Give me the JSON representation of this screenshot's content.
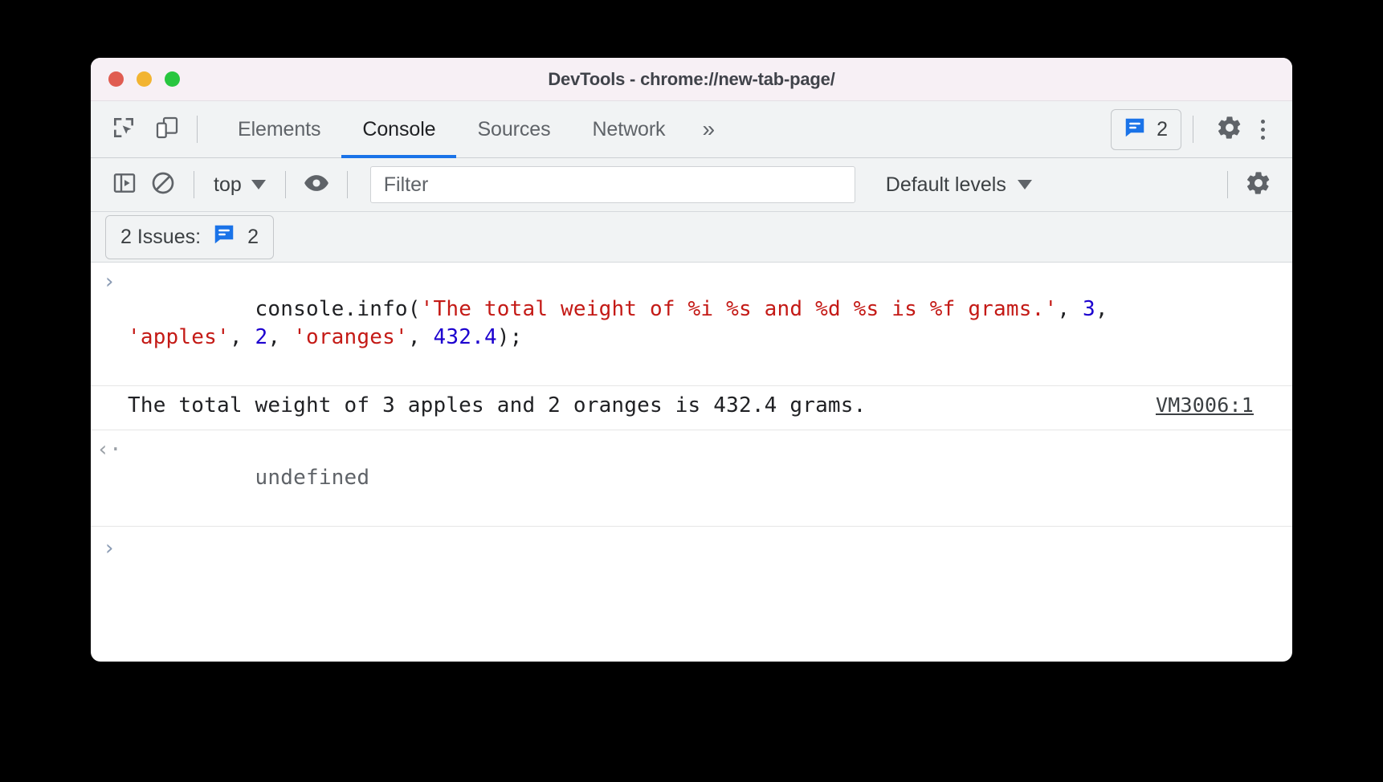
{
  "window": {
    "title": "DevTools - chrome://new-tab-page/",
    "traffic_lights": [
      {
        "name": "close",
        "color": "#e05c51"
      },
      {
        "name": "minimize",
        "color": "#f2b431"
      },
      {
        "name": "zoom",
        "color": "#28c63f"
      }
    ]
  },
  "tabbar": {
    "icons": [
      {
        "name": "inspect-element-icon",
        "label": "Inspect element"
      },
      {
        "name": "device-toolbar-icon",
        "label": "Toggle device toolbar"
      }
    ],
    "tabs": [
      {
        "label": "Elements",
        "active": false
      },
      {
        "label": "Console",
        "active": true
      },
      {
        "label": "Sources",
        "active": false
      },
      {
        "label": "Network",
        "active": false
      }
    ],
    "overflow_label": "»",
    "issues_badge": {
      "count": "2",
      "icon": "issues-icon",
      "color": "#1a73e8"
    },
    "settings_label": "Settings",
    "more_label": "Customize and control DevTools"
  },
  "console_toolbar": {
    "sidebar_toggle": "console-sidebar-icon",
    "clear_console": "clear-console-icon",
    "context_selector": {
      "value": "top"
    },
    "live_expression": "eye-icon",
    "filter": {
      "placeholder": "Filter",
      "value": ""
    },
    "levels": {
      "value": "Default levels"
    },
    "settings": "console-settings-icon"
  },
  "issues_bar": {
    "label": "2 Issues:",
    "count": "2",
    "icon": "issues-icon"
  },
  "console": {
    "input_marker": "›",
    "output_marker": "‹·",
    "entries": [
      {
        "type": "input",
        "line1": [
          {
            "t": "console.info(",
            "c": "plain"
          },
          {
            "t": "'The total weight of %i %s and %d %s is %f grams.'",
            "c": "str"
          },
          {
            "t": ", ",
            "c": "plain"
          },
          {
            "t": "3",
            "c": "num"
          },
          {
            "t": ",",
            "c": "plain"
          }
        ],
        "line2": [
          {
            "t": "'apples'",
            "c": "str"
          },
          {
            "t": ", ",
            "c": "plain"
          },
          {
            "t": "2",
            "c": "num"
          },
          {
            "t": ", ",
            "c": "plain"
          },
          {
            "t": "'oranges'",
            "c": "str"
          },
          {
            "t": ", ",
            "c": "plain"
          },
          {
            "t": "432.4",
            "c": "num"
          },
          {
            "t": ");",
            "c": "plain"
          }
        ]
      },
      {
        "type": "log",
        "message": "The total weight of 3 apples and 2 oranges is 432.4 grams.",
        "source": "VM3006:1"
      },
      {
        "type": "result",
        "message": "undefined"
      }
    ]
  }
}
